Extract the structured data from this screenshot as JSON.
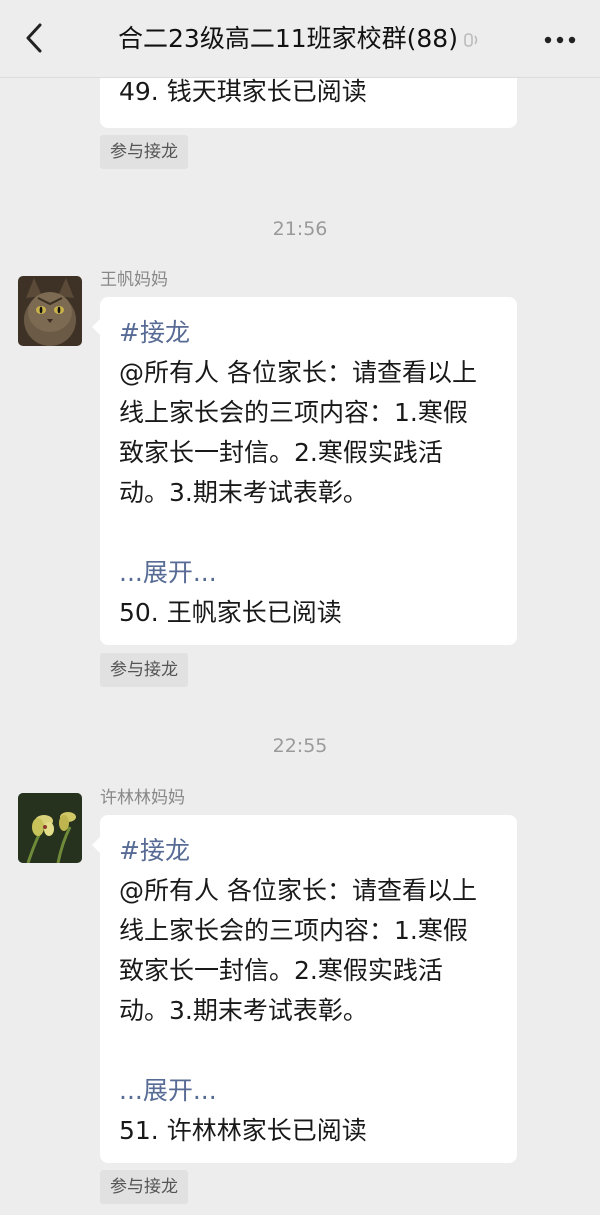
{
  "header": {
    "title": "合二23级高二11班家校群(88)",
    "back_icon": "chevron-left-icon",
    "mute_icon": "mute-icon",
    "more_icon": "more-icon"
  },
  "messages": [
    {
      "footer": "49. 钱天琪家长已阅读",
      "chip": "参与接龙"
    },
    {
      "time": "21:56",
      "sender": "王帆妈妈",
      "tag": "#接龙",
      "lines": [
        "@所有人 各位家长：请查看以上",
        "线上家长会的三项内容：1.寒假",
        "致家长一封信。2.寒假实践活",
        "动。3.期末考试表彰。"
      ],
      "expand": "...展开...",
      "footer": "50. 王帆家长已阅读",
      "chip": "参与接龙"
    },
    {
      "time": "22:55",
      "sender": "许林林妈妈",
      "tag": "#接龙",
      "lines": [
        "@所有人 各位家长：请查看以上",
        "线上家长会的三项内容：1.寒假",
        "致家长一封信。2.寒假实践活",
        "动。3.期末考试表彰。"
      ],
      "expand": "...展开...",
      "footer": "51. 许林林家长已阅读",
      "chip": "参与接龙"
    }
  ]
}
